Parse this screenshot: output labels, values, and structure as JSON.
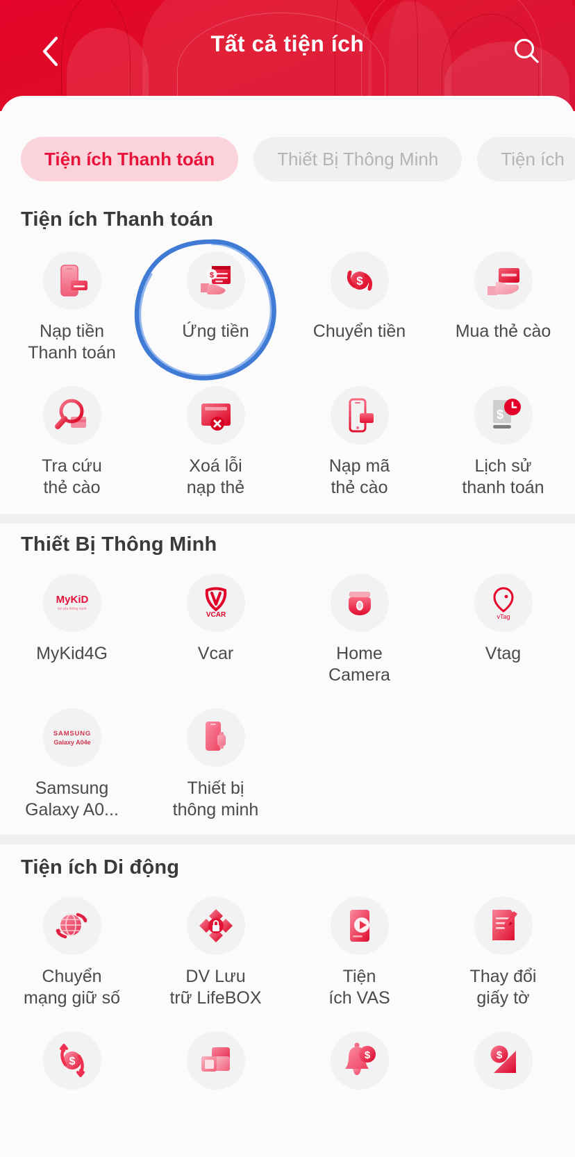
{
  "header": {
    "title": "Tất cả tiện ích",
    "back_icon": "chevron-left-icon",
    "search_icon": "search-icon",
    "brand_color": "#e4042a"
  },
  "tabs": [
    {
      "label": "Tiện ích Thanh toán",
      "active": true
    },
    {
      "label": "Thiết Bị Thông Minh",
      "active": false
    },
    {
      "label": "Tiện ích",
      "active": false
    }
  ],
  "annotation": {
    "type": "hand-drawn-ellipse",
    "color": "#2f6fd0",
    "target_label": "Ứng tiền"
  },
  "sections": [
    {
      "title": "Tiện ích Thanh toán",
      "items": [
        {
          "label": "Nạp tiền\nThanh toán",
          "icon": "phone-topup-icon"
        },
        {
          "label": "Ứng tiền",
          "icon": "hand-invoice-icon"
        },
        {
          "label": "Chuyển tiền",
          "icon": "money-transfer-icon"
        },
        {
          "label": "Mua thẻ cào",
          "icon": "hand-card-icon"
        },
        {
          "label": "Tra cứu\nthẻ cào",
          "icon": "magnifier-card-icon"
        },
        {
          "label": "Xoá lỗi\nnạp thẻ",
          "icon": "card-error-icon"
        },
        {
          "label": "Nạp mã\nthẻ cào",
          "icon": "phone-card-icon"
        },
        {
          "label": "Lịch sử\nthanh toán",
          "icon": "payment-history-icon"
        }
      ]
    },
    {
      "title": "Thiết Bị Thông Minh",
      "items": [
        {
          "label": "MyKid4G",
          "icon": "mykid-logo-icon",
          "badge_text": "MyKiD"
        },
        {
          "label": "Vcar",
          "icon": "vcar-logo-icon",
          "badge_text": "VCAR"
        },
        {
          "label": "Home\nCamera",
          "icon": "home-camera-icon"
        },
        {
          "label": "Vtag",
          "icon": "vtag-logo-icon",
          "badge_text": "vTag"
        },
        {
          "label": "Samsung\nGalaxy A0...",
          "icon": "samsung-galaxy-icon",
          "badge_text": "SAMSUNG\nGalaxy A04e"
        },
        {
          "label": "Thiết bị\nthông minh",
          "icon": "smart-device-icon"
        }
      ]
    },
    {
      "title": "Tiện ích Di động",
      "items": [
        {
          "label": "Chuyển\nmạng giữ số",
          "icon": "globe-swap-icon"
        },
        {
          "label": "DV Lưu\ntrữ LifeBOX",
          "icon": "lifebox-lock-icon"
        },
        {
          "label": "Tiện\ních VAS",
          "icon": "phone-play-icon"
        },
        {
          "label": "Thay đổi\ngiấy tờ",
          "icon": "document-edit-icon"
        },
        {
          "label": "",
          "icon": "money-up-down-icon"
        },
        {
          "label": "",
          "icon": "stacked-cards-icon"
        },
        {
          "label": "",
          "icon": "bell-money-icon"
        },
        {
          "label": "",
          "icon": "money-chart-icon"
        }
      ]
    }
  ]
}
